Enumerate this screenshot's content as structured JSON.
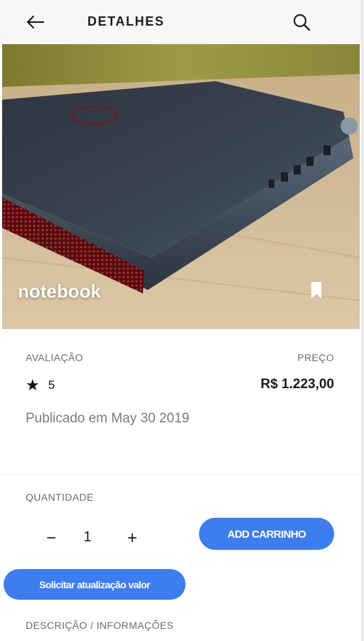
{
  "header": {
    "title": "DETALHES",
    "back_icon": "arrow-left-icon",
    "search_icon": "search-icon"
  },
  "product": {
    "name": "notebook",
    "bookmark_icon": "bookmark-icon",
    "rating_label": "AVALIAÇÃO",
    "rating_icon": "star-icon",
    "rating_value": "5",
    "price_label": "PREÇO",
    "price": "R$ 1.223,00",
    "published": "Publicado em May 30 2019"
  },
  "purchase": {
    "quantity_label": "QUANTIDADE",
    "minus": "−",
    "quantity": "1",
    "plus": "+",
    "add_to_cart": "ADD CARRINHO",
    "request_update": "Solicitar atualização valor"
  },
  "description": {
    "label": "DESCRIÇÃO / INFORMAÇÕES"
  },
  "colors": {
    "accent": "#3d7ded",
    "header_bg": "#f7f7f7",
    "text_muted": "#6b6b6b"
  }
}
